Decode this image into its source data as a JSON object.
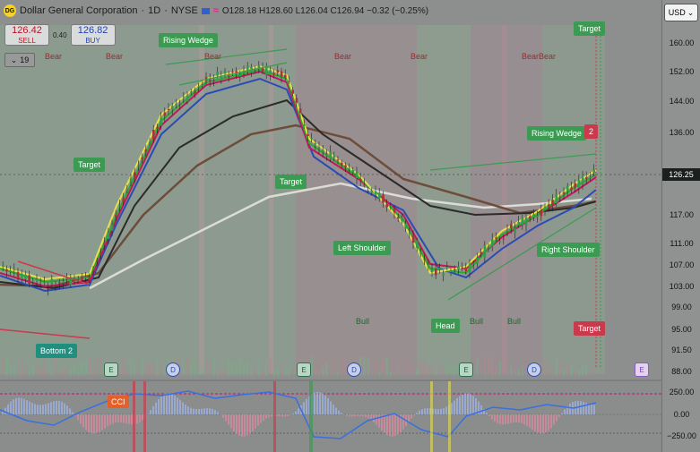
{
  "header": {
    "symbol_name": "Dollar General Corporation",
    "interval": "1D",
    "exchange": "NYSE",
    "ohlc_text": "O128.18 H128.60 L126.04 C126.94 −0.32 (−0.25%)"
  },
  "trade": {
    "sell_price": "126.42",
    "sell_label": "SELL",
    "spread": "0.40",
    "buy_price": "126.82",
    "buy_label": "BUY"
  },
  "indicator_count": "19",
  "currency": "USD",
  "price_label": "126.25",
  "axis_ticks": [
    "160.00",
    "152.00",
    "144.00",
    "136.00",
    "126.25",
    "117.00",
    "111.00",
    "107.00",
    "103.00",
    "99.00",
    "95.00",
    "91.50",
    "88.00",
    "250.00",
    "0.00",
    "−250.00"
  ],
  "labels": {
    "rising_wedge_1": "Rising Wedge",
    "rising_wedge_2": "Rising Wedge",
    "target_top": "Target",
    "target_left": "Target",
    "target_mid": "Target",
    "target_right": "Target",
    "left_shoulder": "Left Shoulder",
    "right_shoulder": "Right Shoulder",
    "head": "Head",
    "bottom2": "Bottom 2",
    "badge_2": "2",
    "cci": "CCI"
  },
  "bear_labels": [
    "Bear",
    "Bear",
    "Bear",
    "Bear",
    "Bear",
    "BearBear"
  ],
  "bull_labels": [
    "Bull",
    "Bull",
    "Bull"
  ],
  "events": {
    "e": "E",
    "d": "D"
  },
  "colors": {
    "up": "#2e9e48",
    "down": "#b0303a",
    "ema1": "#e6e04a",
    "ema2": "#2ea82e",
    "ema3": "#2b4bb5",
    "ema4": "#c0185a"
  }
}
